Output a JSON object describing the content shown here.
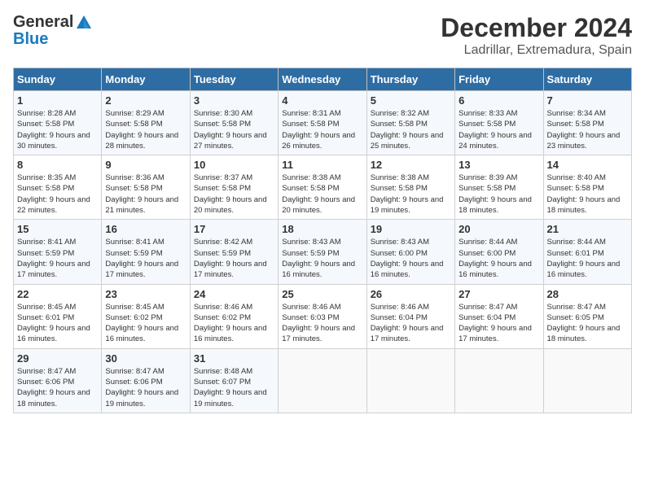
{
  "header": {
    "logo_line1": "General",
    "logo_line2": "Blue",
    "month": "December 2024",
    "location": "Ladrillar, Extremadura, Spain"
  },
  "weekdays": [
    "Sunday",
    "Monday",
    "Tuesday",
    "Wednesday",
    "Thursday",
    "Friday",
    "Saturday"
  ],
  "weeks": [
    [
      {
        "day": "1",
        "sunrise": "8:28 AM",
        "sunset": "5:58 PM",
        "daylight": "9 hours and 30 minutes."
      },
      {
        "day": "2",
        "sunrise": "8:29 AM",
        "sunset": "5:58 PM",
        "daylight": "9 hours and 28 minutes."
      },
      {
        "day": "3",
        "sunrise": "8:30 AM",
        "sunset": "5:58 PM",
        "daylight": "9 hours and 27 minutes."
      },
      {
        "day": "4",
        "sunrise": "8:31 AM",
        "sunset": "5:58 PM",
        "daylight": "9 hours and 26 minutes."
      },
      {
        "day": "5",
        "sunrise": "8:32 AM",
        "sunset": "5:58 PM",
        "daylight": "9 hours and 25 minutes."
      },
      {
        "day": "6",
        "sunrise": "8:33 AM",
        "sunset": "5:58 PM",
        "daylight": "9 hours and 24 minutes."
      },
      {
        "day": "7",
        "sunrise": "8:34 AM",
        "sunset": "5:58 PM",
        "daylight": "9 hours and 23 minutes."
      }
    ],
    [
      {
        "day": "8",
        "sunrise": "8:35 AM",
        "sunset": "5:58 PM",
        "daylight": "9 hours and 22 minutes."
      },
      {
        "day": "9",
        "sunrise": "8:36 AM",
        "sunset": "5:58 PM",
        "daylight": "9 hours and 21 minutes."
      },
      {
        "day": "10",
        "sunrise": "8:37 AM",
        "sunset": "5:58 PM",
        "daylight": "9 hours and 20 minutes."
      },
      {
        "day": "11",
        "sunrise": "8:38 AM",
        "sunset": "5:58 PM",
        "daylight": "9 hours and 20 minutes."
      },
      {
        "day": "12",
        "sunrise": "8:38 AM",
        "sunset": "5:58 PM",
        "daylight": "9 hours and 19 minutes."
      },
      {
        "day": "13",
        "sunrise": "8:39 AM",
        "sunset": "5:58 PM",
        "daylight": "9 hours and 18 minutes."
      },
      {
        "day": "14",
        "sunrise": "8:40 AM",
        "sunset": "5:58 PM",
        "daylight": "9 hours and 18 minutes."
      }
    ],
    [
      {
        "day": "15",
        "sunrise": "8:41 AM",
        "sunset": "5:59 PM",
        "daylight": "9 hours and 17 minutes."
      },
      {
        "day": "16",
        "sunrise": "8:41 AM",
        "sunset": "5:59 PM",
        "daylight": "9 hours and 17 minutes."
      },
      {
        "day": "17",
        "sunrise": "8:42 AM",
        "sunset": "5:59 PM",
        "daylight": "9 hours and 17 minutes."
      },
      {
        "day": "18",
        "sunrise": "8:43 AM",
        "sunset": "5:59 PM",
        "daylight": "9 hours and 16 minutes."
      },
      {
        "day": "19",
        "sunrise": "8:43 AM",
        "sunset": "6:00 PM",
        "daylight": "9 hours and 16 minutes."
      },
      {
        "day": "20",
        "sunrise": "8:44 AM",
        "sunset": "6:00 PM",
        "daylight": "9 hours and 16 minutes."
      },
      {
        "day": "21",
        "sunrise": "8:44 AM",
        "sunset": "6:01 PM",
        "daylight": "9 hours and 16 minutes."
      }
    ],
    [
      {
        "day": "22",
        "sunrise": "8:45 AM",
        "sunset": "6:01 PM",
        "daylight": "9 hours and 16 minutes."
      },
      {
        "day": "23",
        "sunrise": "8:45 AM",
        "sunset": "6:02 PM",
        "daylight": "9 hours and 16 minutes."
      },
      {
        "day": "24",
        "sunrise": "8:46 AM",
        "sunset": "6:02 PM",
        "daylight": "9 hours and 16 minutes."
      },
      {
        "day": "25",
        "sunrise": "8:46 AM",
        "sunset": "6:03 PM",
        "daylight": "9 hours and 17 minutes."
      },
      {
        "day": "26",
        "sunrise": "8:46 AM",
        "sunset": "6:04 PM",
        "daylight": "9 hours and 17 minutes."
      },
      {
        "day": "27",
        "sunrise": "8:47 AM",
        "sunset": "6:04 PM",
        "daylight": "9 hours and 17 minutes."
      },
      {
        "day": "28",
        "sunrise": "8:47 AM",
        "sunset": "6:05 PM",
        "daylight": "9 hours and 18 minutes."
      }
    ],
    [
      {
        "day": "29",
        "sunrise": "8:47 AM",
        "sunset": "6:06 PM",
        "daylight": "9 hours and 18 minutes."
      },
      {
        "day": "30",
        "sunrise": "8:47 AM",
        "sunset": "6:06 PM",
        "daylight": "9 hours and 19 minutes."
      },
      {
        "day": "31",
        "sunrise": "8:48 AM",
        "sunset": "6:07 PM",
        "daylight": "9 hours and 19 minutes."
      },
      null,
      null,
      null,
      null
    ]
  ]
}
